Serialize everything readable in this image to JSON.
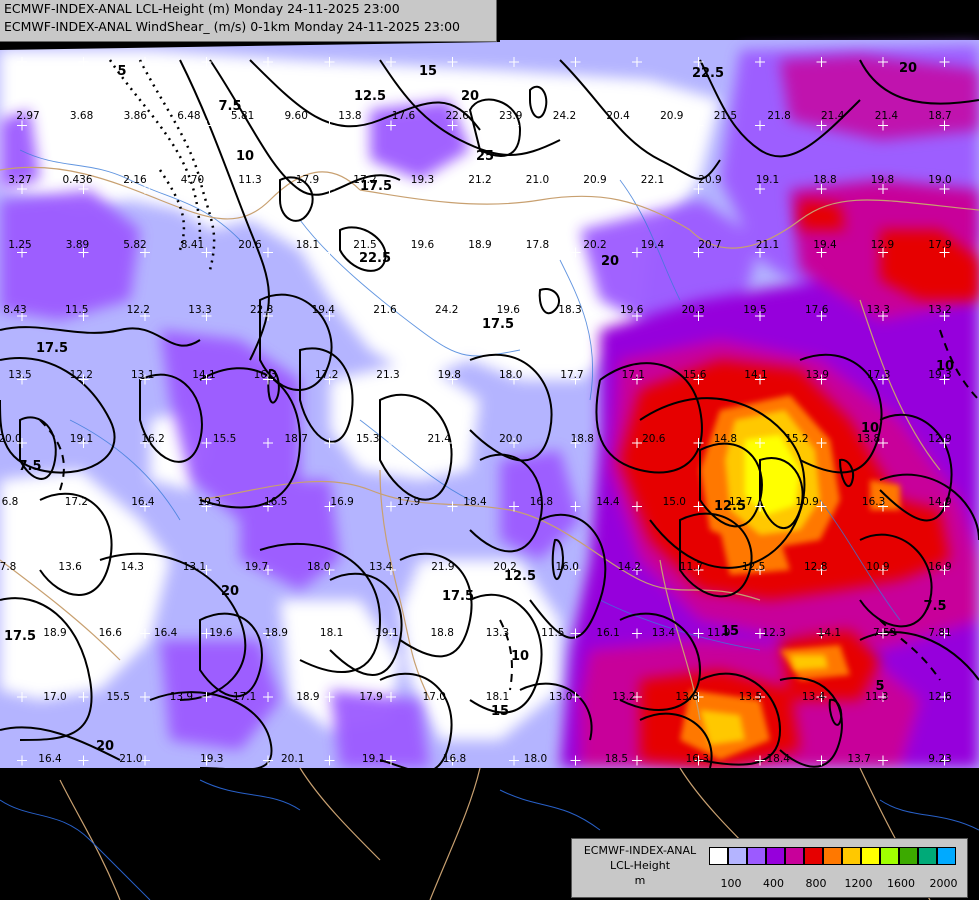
{
  "header": {
    "line1": "ECMWF-INDEX-ANAL LCL-Height (m) Monday 24-11-2025 23:00",
    "line2": "ECMWF-INDEX-ANAL WindShear_ (m/s) 0-1km Monday 24-11-2025 23:00"
  },
  "legend": {
    "title1": "ECMWF-INDEX-ANAL",
    "title2": "LCL-Height",
    "unit": "m",
    "colors": [
      "#ffffff",
      "#b4b4ff",
      "#9c5aff",
      "#9600dc",
      "#c8009a",
      "#e60000",
      "#ff7800",
      "#ffc800",
      "#ffff00",
      "#a0ff00",
      "#3caa00",
      "#00aa78",
      "#00aaff"
    ],
    "ticks": [
      "100",
      "400",
      "800",
      "1200",
      "1600",
      "2000"
    ]
  },
  "contour_labels": [
    "22.5",
    "20",
    "15",
    "12.5",
    "7.5",
    "10",
    "5",
    "17.5",
    "25",
    "20",
    "17.5",
    "22.5",
    "17.5",
    "20",
    "12.5",
    "10",
    "7.5",
    "17.5",
    "12.5",
    "15",
    "20",
    "17.5",
    "15",
    "20",
    "10",
    "7.5",
    "5",
    "10"
  ],
  "value_labels": [
    "2.97",
    "3.68",
    "3.86",
    "6.48",
    "5.81",
    "9.60",
    "13.8",
    "17.6",
    "22.6",
    "23.9",
    "24.2",
    "20.4",
    "20.9",
    "21.5",
    "21.8",
    "21.4",
    "21.4",
    "18.7",
    "3.27",
    "0.436",
    "2.16",
    "4.70",
    "11.3",
    "17.9",
    "17.2",
    "19.3",
    "21.2",
    "21.0",
    "20.9",
    "22.1",
    "20.9",
    "19.1",
    "18.8",
    "19.8",
    "19.0",
    "1.25",
    "3.89",
    "5.82",
    "8.41",
    "20.6",
    "18.1",
    "21.5",
    "19.6",
    "18.9",
    "17.8",
    "20.2",
    "19.4",
    "20.7",
    "21.1",
    "19.4",
    "12.9",
    "17.9",
    "8.43",
    "11.5",
    "12.2",
    "13.3",
    "22.3",
    "19.4",
    "21.6",
    "24.2",
    "19.6",
    "18.3",
    "19.6",
    "20.3",
    "19.5",
    "17.6",
    "13.3",
    "13.2",
    "13.5",
    "12.2",
    "13.1",
    "14.1",
    "16.3",
    "17.2",
    "21.3",
    "19.8",
    "18.0",
    "17.7",
    "17.1",
    "15.6",
    "14.1",
    "13.9",
    "17.3",
    "19.3",
    "20.0",
    "19.1",
    "16.2",
    "15.5",
    "18.7",
    "15.3",
    "21.4",
    "20.0",
    "18.8",
    "20.6",
    "14.8",
    "15.2",
    "13.8",
    "12.9",
    "6.8",
    "17.2",
    "16.4",
    "19.3",
    "16.5",
    "16.9",
    "17.9",
    "18.4",
    "16.8",
    "14.4",
    "15.0",
    "12.7",
    "10.9",
    "16.3",
    "14.9",
    "7.8",
    "13.6",
    "14.3",
    "13.1",
    "19.7",
    "18.0",
    "13.4",
    "21.9",
    "20.2",
    "16.0",
    "14.2",
    "11.7",
    "12.5",
    "12.8",
    "10.9",
    "16.9",
    "18.9",
    "16.6",
    "16.4",
    "19.6",
    "18.9",
    "18.1",
    "19.1",
    "18.8",
    "13.3",
    "11.5",
    "16.1",
    "13.4",
    "11.9",
    "12.3",
    "14.1",
    "7.53",
    "7.81",
    "17.0",
    "15.5",
    "13.9",
    "17.1",
    "18.9",
    "17.9",
    "17.0",
    "18.1",
    "13.0",
    "13.2",
    "13.8",
    "13.5",
    "13.4",
    "11.3",
    "12.6",
    "16.4",
    "21.0",
    "19.3",
    "20.1",
    "19.1",
    "16.8",
    "18.0",
    "18.5",
    "16.3",
    "18.4",
    "13.7",
    "9.23"
  ]
}
